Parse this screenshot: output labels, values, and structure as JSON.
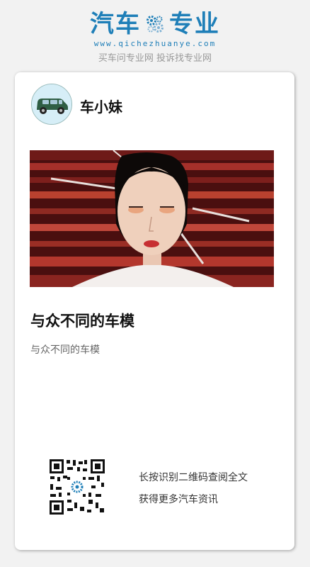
{
  "header": {
    "logo_left": "汽车",
    "logo_right": "专业",
    "domain": "www.qichezhuanye.com",
    "slogan": "买车问专业网 投诉找专业网"
  },
  "author": {
    "name": "车小妹"
  },
  "article": {
    "title": "与众不同的车模",
    "summary": "与众不同的车模"
  },
  "qr_section": {
    "line1": "长按识别二维码查阅全文",
    "line2": "获得更多汽车资讯"
  },
  "colors": {
    "brand": "#1f7fb8",
    "background": "#f2f2f2",
    "card": "#ffffff"
  }
}
